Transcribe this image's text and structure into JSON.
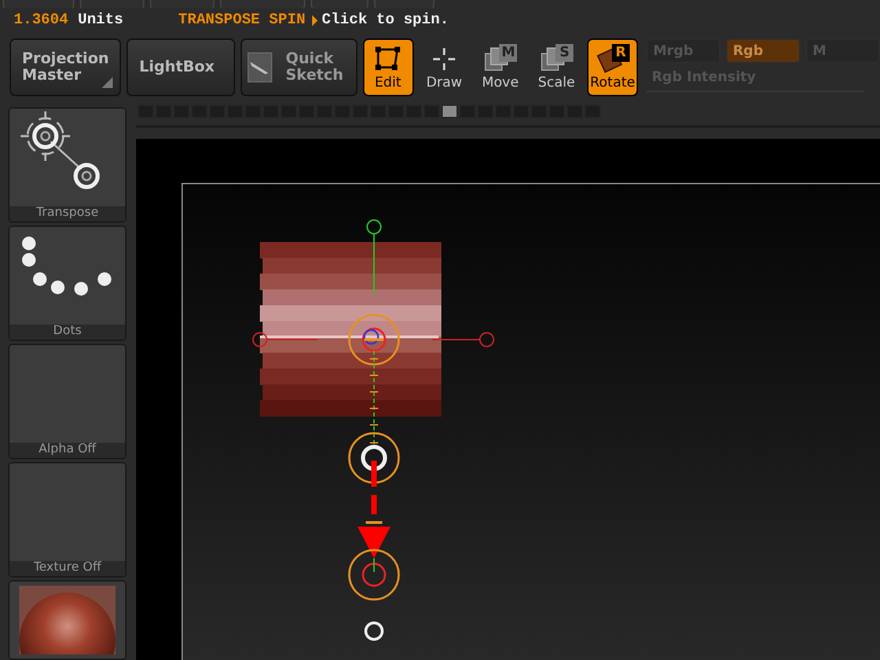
{
  "status": {
    "units_value": "1.3604",
    "units_label": "Units",
    "mode": "TRANSPOSE SPIN",
    "hint": "Click to spin."
  },
  "large_buttons": [
    {
      "label": "Projection Master",
      "kind": "menu"
    },
    {
      "label": "LightBox",
      "kind": "plain"
    },
    {
      "label": "Quick Sketch",
      "kind": "icon"
    }
  ],
  "tools": [
    {
      "label": "Edit",
      "kind": "edit",
      "selected": true
    },
    {
      "label": "Draw",
      "kind": "draw",
      "selected": false
    },
    {
      "label": "Move",
      "kind": "move",
      "selected": false,
      "hotkey": "M"
    },
    {
      "label": "Scale",
      "kind": "scale",
      "selected": false,
      "hotkey": "S"
    },
    {
      "label": "Rotate",
      "kind": "rotate",
      "selected": true,
      "hotkey": "R"
    }
  ],
  "color_modes": [
    {
      "label": "Mrgb",
      "selected": false
    },
    {
      "label": "Rgb",
      "selected": true
    },
    {
      "label": "M",
      "selected": false
    }
  ],
  "rgb_intensity": {
    "label": "Rgb Intensity"
  },
  "tray": [
    {
      "label": "Transpose",
      "kind": "transpose"
    },
    {
      "label": "Dots",
      "kind": "dots"
    },
    {
      "label": "Alpha Off",
      "kind": "empty"
    },
    {
      "label": "Texture Off",
      "kind": "empty"
    },
    {
      "kind": "material"
    }
  ],
  "undo_history": [
    {
      "selected": false
    },
    {
      "selected": false
    },
    {
      "selected": false
    },
    {
      "selected": false
    },
    {
      "selected": false
    },
    {
      "selected": false
    },
    {
      "selected": false
    },
    {
      "selected": false
    },
    {
      "selected": false
    },
    {
      "selected": false
    },
    {
      "selected": false
    },
    {
      "selected": false
    },
    {
      "selected": false
    },
    {
      "selected": false
    },
    {
      "selected": false
    },
    {
      "selected": false
    },
    {
      "selected": false
    },
    {
      "selected": true
    },
    {
      "selected": false
    },
    {
      "selected": false
    },
    {
      "selected": false
    },
    {
      "selected": false
    },
    {
      "selected": false
    },
    {
      "selected": false
    },
    {
      "selected": false
    },
    {
      "selected": false
    }
  ]
}
